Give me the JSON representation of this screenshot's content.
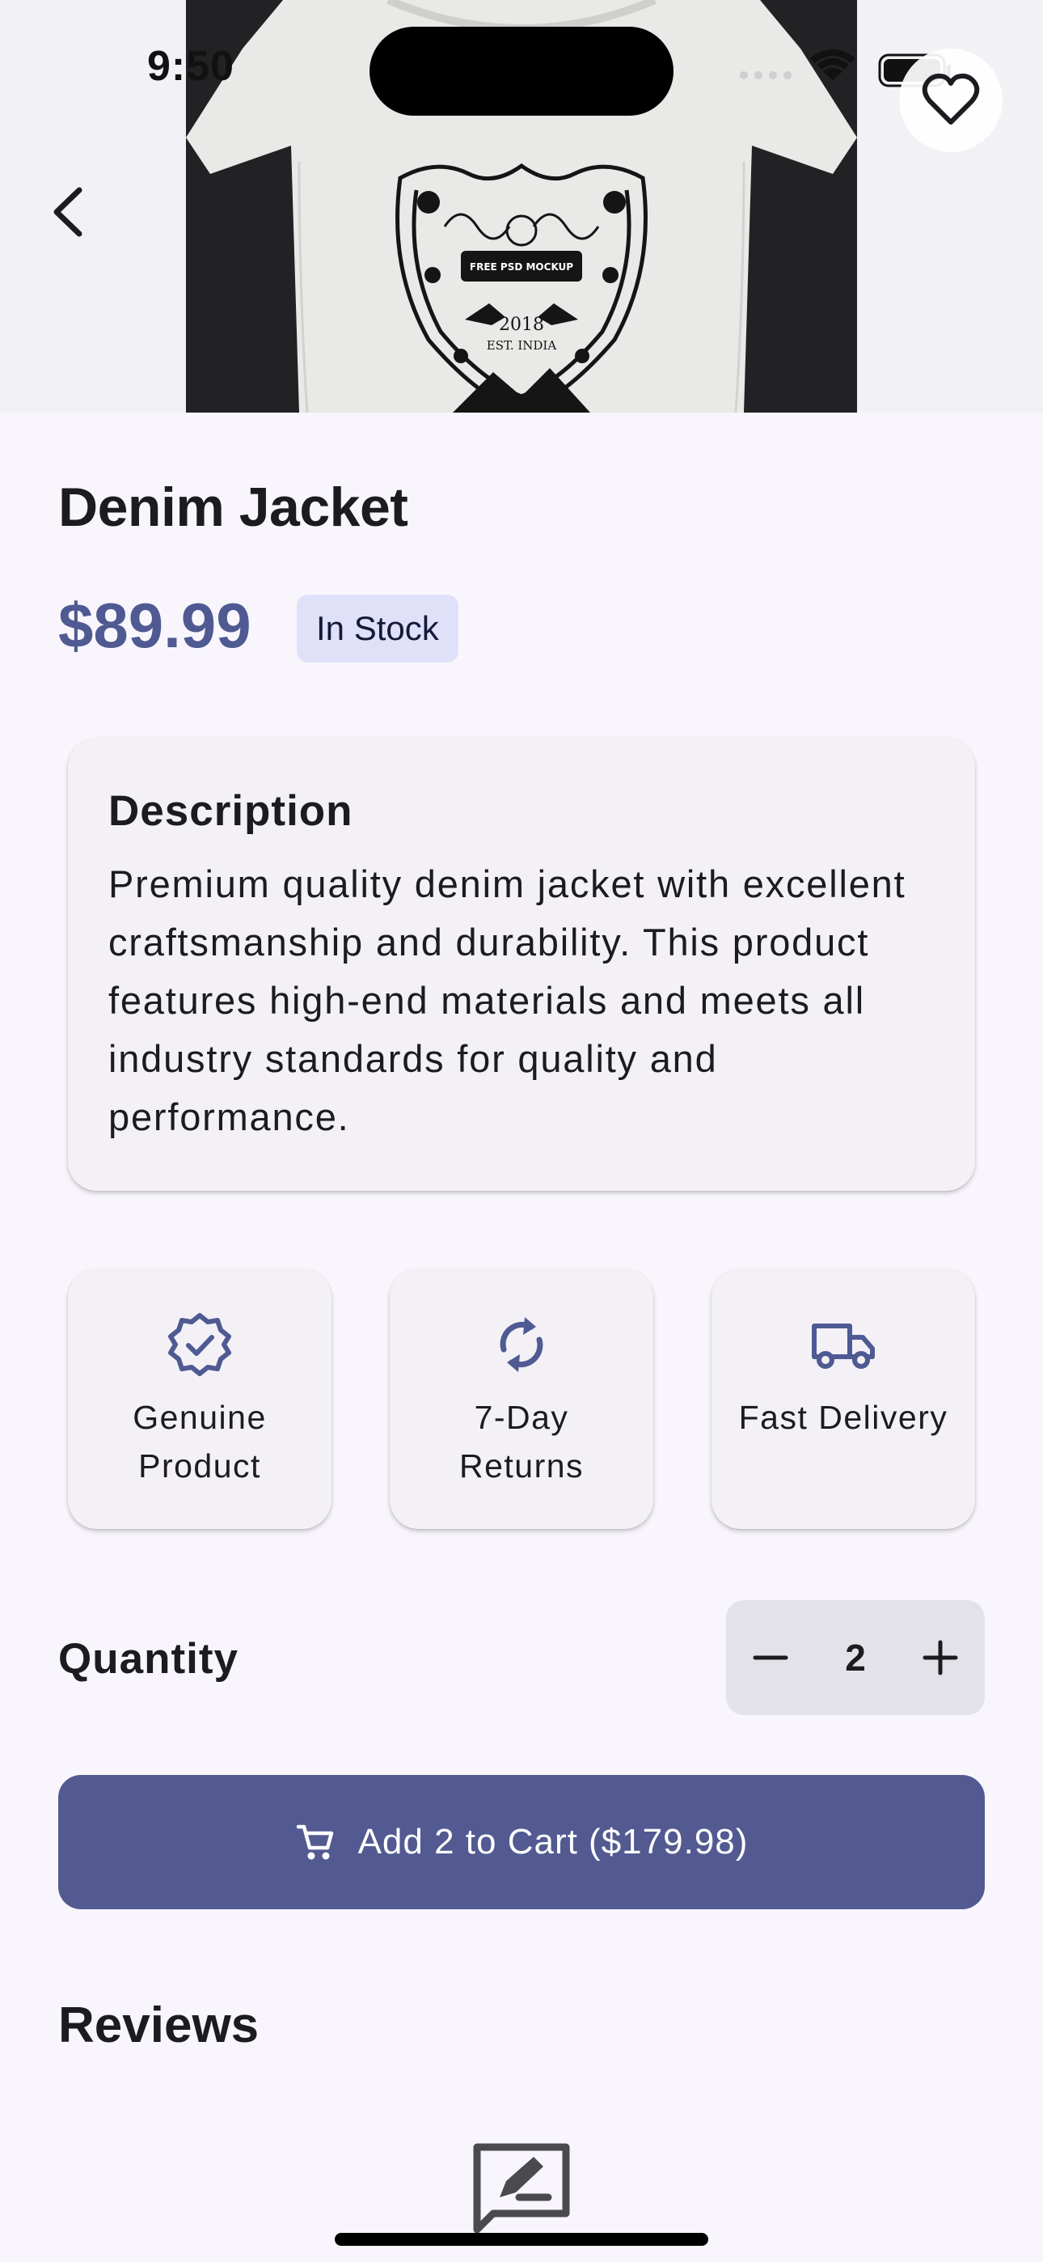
{
  "status_bar": {
    "time": "9:50"
  },
  "product": {
    "title": "Denim Jacket",
    "price": "$89.99",
    "stock_status": "In Stock"
  },
  "description": {
    "heading": "Description",
    "body": "Premium quality denim jacket with excellent craftsmanship and durability. This product features high-end materials and meets all industry standards for quality and performance."
  },
  "features": [
    {
      "icon": "verified-badge-icon",
      "label": "Genuine Product"
    },
    {
      "icon": "sync-icon",
      "label": "7-Day Returns"
    },
    {
      "icon": "truck-icon",
      "label": "Fast Delivery"
    }
  ],
  "quantity": {
    "label": "Quantity",
    "value": "2"
  },
  "cart_button": {
    "icon": "cart-icon",
    "label": "Add 2 to Cart ($179.98)"
  },
  "reviews": {
    "heading": "Reviews",
    "empty_icon": "rate-review-icon"
  },
  "image_text": {
    "brand": "FREE PSD MOCKUP",
    "year": "2018",
    "origin": "EST. INDIA"
  },
  "colors": {
    "accent": "#525a91",
    "price": "#4f5a92",
    "badge_bg": "#e0e1f9",
    "background": "#f8f6fc",
    "card_bg": "#f3f1f6"
  }
}
